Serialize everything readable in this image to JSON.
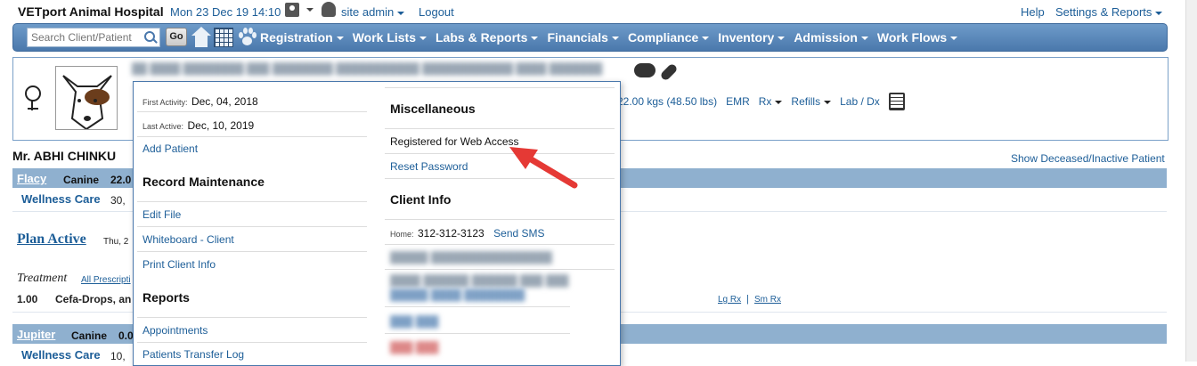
{
  "top": {
    "brand": "VETport Animal Hospital",
    "datetime": "Mon 23 Dec 19 14:10",
    "user": "site admin",
    "logout": "Logout",
    "help": "Help",
    "settings": "Settings & Reports"
  },
  "nav": {
    "search_placeholder": "Search Client/Patient",
    "go": "Go",
    "menus": [
      "Registration",
      "Work Lists",
      "Labs & Reports",
      "Financials",
      "Compliance",
      "Inventory",
      "Admission",
      "Work Flows"
    ]
  },
  "patient_panel": {
    "weight": "22.00 kgs (48.50 lbs)",
    "emr": "EMR",
    "rx": "Rx",
    "refills": "Refills",
    "lab_dx": "Lab / Dx"
  },
  "client": {
    "name": "Mr. ABHI CHINKU",
    "show_deceased": "Show Deceased/Inactive Patient"
  },
  "pets": [
    {
      "name": "Flacy",
      "species": "Canine",
      "weight_prefix": "22.0",
      "plan": "Wellness Care",
      "plan_date": "30,"
    },
    {
      "name": "Jupiter",
      "species": "Canine",
      "weight_prefix": "0.0",
      "plan": "Wellness Care",
      "plan_date": "10,"
    }
  ],
  "plan": {
    "title": "Plan Active",
    "date_prefix": "Thu, 2",
    "treatment": "Treatment",
    "all_rx": "All Prescripti",
    "qty": "1.00",
    "drug": "Cefa-Drops, an",
    "lg_rx": "Lg Rx",
    "sep": "|",
    "sm_rx": "Sm Rx"
  },
  "dropdown": {
    "first_activity_label": "First Activity:",
    "first_activity": "Dec, 04, 2018",
    "last_active_label": "Last Active:",
    "last_active": "Dec, 10, 2019",
    "add_patient": "Add Patient",
    "record_maintenance": "Record Maintenance",
    "edit_file": "Edit File",
    "whiteboard": "Whiteboard - Client",
    "print_client_info": "Print Client Info",
    "reports": "Reports",
    "appointments": "Appointments",
    "transfer_log": "Patients Transfer Log",
    "misc": "Miscellaneous",
    "registered_web": "Registered for Web Access",
    "reset_password": "Reset Password",
    "client_info": "Client Info",
    "home_label": "Home:",
    "home_phone": "312-312-3123",
    "send_sms": "Send SMS"
  },
  "colors": {
    "nav": "#4a78ac",
    "link": "#1d5e98",
    "band": "#8fb0cf",
    "arrow": "#e53935"
  }
}
